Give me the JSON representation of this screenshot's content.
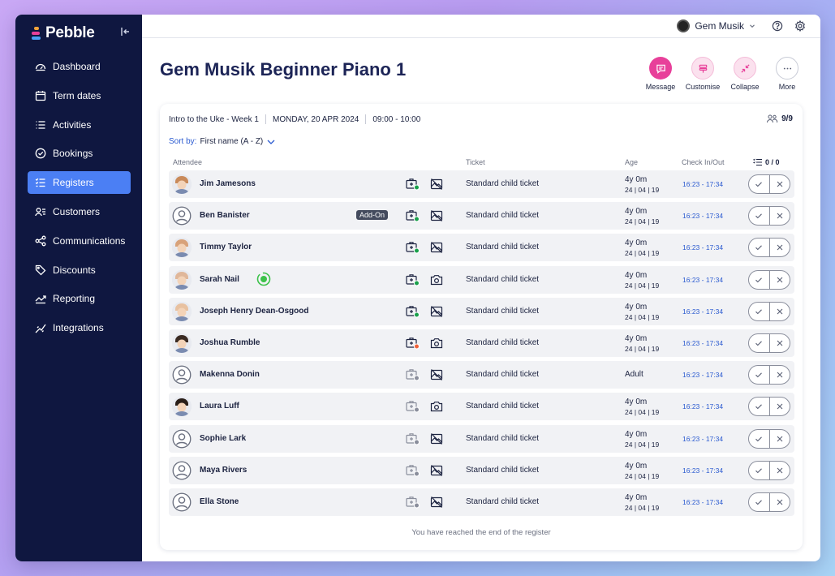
{
  "app": {
    "brand": "Pebble"
  },
  "sidebar": {
    "items": [
      {
        "label": "Dashboard",
        "icon": "dashboard-icon",
        "active": false
      },
      {
        "label": "Term dates",
        "icon": "calendar-icon",
        "active": false
      },
      {
        "label": "Activities",
        "icon": "list-icon",
        "active": false
      },
      {
        "label": "Bookings",
        "icon": "check-circle-icon",
        "active": false
      },
      {
        "label": "Registers",
        "icon": "checklist-icon",
        "active": true
      },
      {
        "label": "Customers",
        "icon": "customers-icon",
        "active": false
      },
      {
        "label": "Communications",
        "icon": "share-icon",
        "active": false
      },
      {
        "label": "Discounts",
        "icon": "tag-icon",
        "active": false
      },
      {
        "label": "Reporting",
        "icon": "trend-icon",
        "active": false
      },
      {
        "label": "Integrations",
        "icon": "integrations-icon",
        "active": false
      }
    ]
  },
  "header": {
    "user": "Gem Musik"
  },
  "page": {
    "title": "Gem Musik Beginner Piano 1"
  },
  "actions": [
    {
      "label": "Message",
      "icon": "message-icon"
    },
    {
      "label": "Customise",
      "icon": "customise-icon"
    },
    {
      "label": "Collapse",
      "icon": "collapse-icon"
    },
    {
      "label": "More",
      "icon": "more-icon"
    }
  ],
  "session": {
    "name": "Intro to the Uke - Week 1",
    "date": "MONDAY, 20 APR 2024",
    "time": "09:00 - 10:00",
    "capacity": "9/9"
  },
  "sort": {
    "label": "Sort by:",
    "value": "First name (A - Z)"
  },
  "columns": {
    "attendee": "Attendee",
    "ticket": "Ticket",
    "age": "Age",
    "checkin": "Check In/Out",
    "count": "0 / 0"
  },
  "attendees": [
    {
      "name": "Jim Jamesons",
      "photo": true,
      "tone": "#c98a5a",
      "ticket": "Standard child ticket",
      "age": "4y 0m",
      "dob": "24 | 04 | 19",
      "time": "16:23 - 17:34",
      "medical": "green",
      "photo_consent": false
    },
    {
      "name": "Ben Banister",
      "photo": false,
      "addon": "Add-On",
      "ticket": "Standard child ticket",
      "age": "4y 0m",
      "dob": "24 | 04 | 19",
      "time": "16:23 - 17:34",
      "medical": "green",
      "photo_consent": false
    },
    {
      "name": "Timmy Taylor",
      "photo": true,
      "tone": "#d8a27a",
      "ticket": "Standard child ticket",
      "age": "4y 0m",
      "dob": "24 | 04 | 19",
      "time": "16:23 - 17:34",
      "medical": "green",
      "photo_consent": false
    },
    {
      "name": "Sarah Nail",
      "photo": true,
      "tone": "#e0b79a",
      "badge": true,
      "ticket": "Standard child ticket",
      "age": "4y 0m",
      "dob": "24 | 04 | 19",
      "time": "16:23 - 17:34",
      "medical": "green",
      "photo_consent": true
    },
    {
      "name": "Joseph Henry Dean-Osgood",
      "photo": true,
      "tone": "#e8c1a0",
      "ticket": "Standard child ticket",
      "age": "4y 0m",
      "dob": "24 | 04 | 19",
      "time": "16:23 - 17:34",
      "medical": "green",
      "photo_consent": false
    },
    {
      "name": "Joshua Rumble",
      "photo": true,
      "tone": "#3a2a22",
      "ticket": "Standard child ticket",
      "age": "4y 0m",
      "dob": "24 | 04 | 19",
      "time": "16:23 - 17:34",
      "medical": "orange",
      "photo_consent": true
    },
    {
      "name": "Makenna Donin",
      "photo": false,
      "ticket": "Standard child ticket",
      "age": "Adult",
      "dob": "",
      "time": "16:23 - 17:34",
      "medical": "grey",
      "photo_consent": false
    },
    {
      "name": "Laura Luff",
      "photo": true,
      "tone": "#2a1e18",
      "ticket": "Standard child ticket",
      "age": "4y 0m",
      "dob": "24 | 04 | 19",
      "time": "16:23 - 17:34",
      "medical": "grey",
      "photo_consent": true
    },
    {
      "name": "Sophie Lark",
      "photo": false,
      "ticket": "Standard child ticket",
      "age": "4y 0m",
      "dob": "24 | 04 | 19",
      "time": "16:23 - 17:34",
      "medical": "grey",
      "photo_consent": false
    },
    {
      "name": "Maya Rivers",
      "photo": false,
      "ticket": "Standard child ticket",
      "age": "4y 0m",
      "dob": "24 | 04 | 19",
      "time": "16:23 - 17:34",
      "medical": "grey",
      "photo_consent": false
    },
    {
      "name": "Ella Stone",
      "photo": false,
      "ticket": "Standard child ticket",
      "age": "4y 0m",
      "dob": "24 | 04 | 19",
      "time": "16:23 - 17:34",
      "medical": "grey",
      "photo_consent": false
    }
  ],
  "footer": {
    "message": "You have reached the end of the register"
  },
  "colors": {
    "sidebar": "#0f1740",
    "accent": "#4b7ff4",
    "message": "#e8409a",
    "link": "#2a5ad0"
  }
}
